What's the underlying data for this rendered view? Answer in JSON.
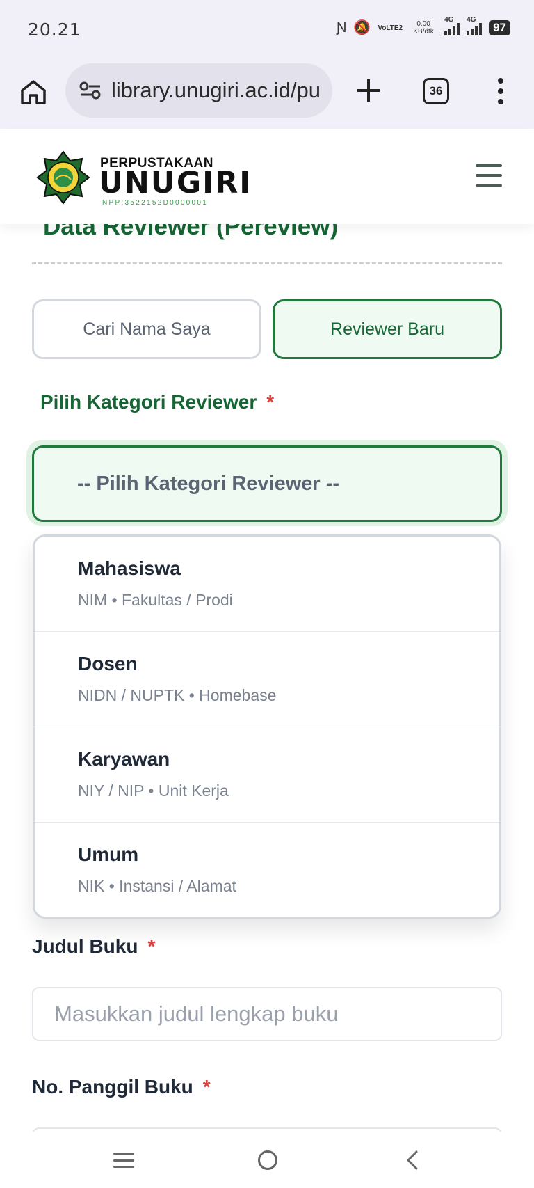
{
  "status_bar": {
    "time": "20.21",
    "network_labels": [
      "VoLTE2",
      "0.00 KB/dtk",
      "4G",
      "4G"
    ],
    "battery": "97"
  },
  "browser": {
    "url": "library.unugiri.ac.id/pu",
    "tab_count": "36"
  },
  "header": {
    "logo_top": "PERPUSTAKAAN",
    "logo_main": "UNUGIRI",
    "logo_npp": "NPP:3522152D0000001"
  },
  "page": {
    "title": "Data Reviewer (Pereview)"
  },
  "segmented": {
    "left_label": "Cari Nama Saya",
    "right_label": "Reviewer Baru"
  },
  "kategori": {
    "label": "Pilih Kategori Reviewer",
    "required_mark": "*",
    "placeholder": "-- Pilih Kategori Reviewer --",
    "options": [
      {
        "title": "Mahasiswa",
        "sub": "NIM • Fakultas / Prodi"
      },
      {
        "title": "Dosen",
        "sub": "NIDN / NUPTK • Homebase"
      },
      {
        "title": "Karyawan",
        "sub": "NIY / NIP • Unit Kerja"
      },
      {
        "title": "Umum",
        "sub": "NIK • Instansi / Alamat"
      }
    ]
  },
  "judul": {
    "label": "Judul Buku",
    "required_mark": "*",
    "placeholder": "Masukkan judul lengkap buku"
  },
  "panggil": {
    "label": "No. Panggil Buku",
    "required_mark": "*"
  },
  "colors": {
    "brand_green": "#166534",
    "accent_green_bg": "#effaf2",
    "required_red": "#e04040"
  }
}
